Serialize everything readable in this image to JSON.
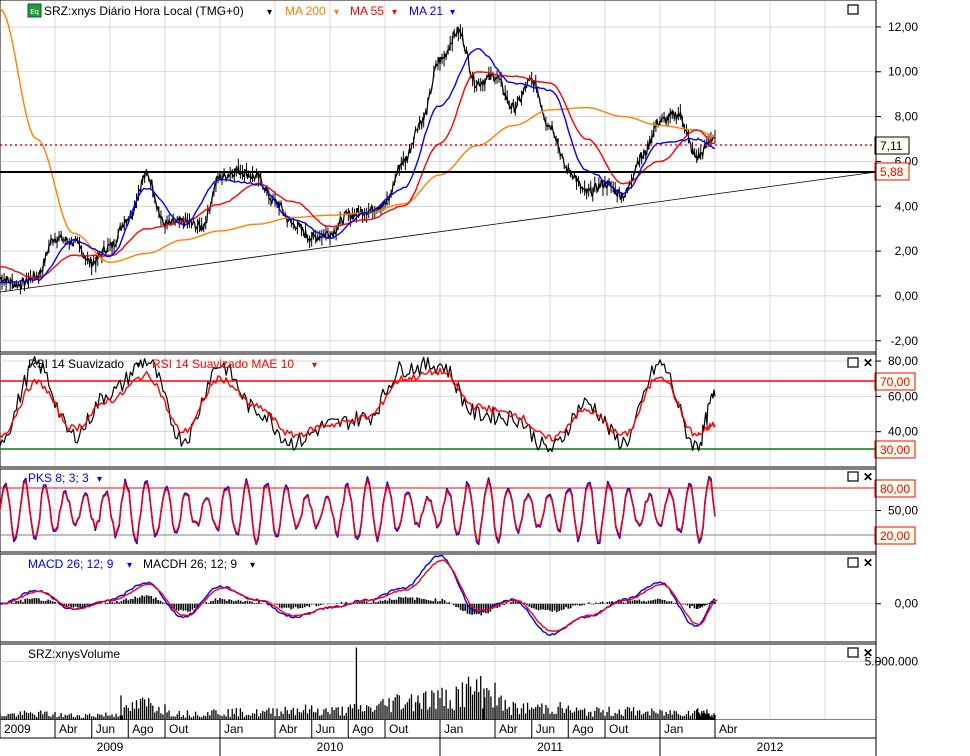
{
  "colors": {
    "price": "#000000",
    "ma200": "#ff8000",
    "ma55": "#ff0000",
    "ma21": "#0000ff",
    "rsi": "#000000",
    "rsi_ma": "#ff0000",
    "pks_k": "#0000ff",
    "pks_d": "#ff0000",
    "macd": "#0000ff",
    "macd_signal": "#ff0000",
    "macdh": "#000000",
    "level_upper": "#ff0000",
    "level_lower": "#008000",
    "volume": "#000000",
    "grid": "#c0c0c0",
    "badge_bg": "#ffffee",
    "badge_red_text": "#ff0000"
  },
  "icons": {
    "close": "close-icon",
    "maximize": "maximize-icon",
    "dropdown": "dropdown-arrow-icon",
    "eq_badge": "eq-badge-icon"
  },
  "price_panel": {
    "symbol_label": "SRZ:xnys Diário Hora Local (TMG+0)",
    "badge_text": "Eq",
    "ma200_label": "MA 200",
    "ma55_label": "MA 55",
    "ma21_label": "MA 21",
    "y_ticks": [
      "12,00",
      "10,00",
      "8,00",
      "6,00",
      "4,00",
      "2,00",
      "0,00",
      "-2,00"
    ],
    "last_price": "7,11",
    "support_level": "5,88"
  },
  "rsi_panel": {
    "label": "RSI 14 Suavizado",
    "ma_label": "RSI 14 Suavizado MAE 10",
    "y_ticks": [
      "80,00",
      "60,00",
      "40,00"
    ],
    "upper_level": "70,00",
    "lower_level": "30,00"
  },
  "pks_panel": {
    "label": "PKS 8; 3; 3",
    "y_ticks": [
      "50,00"
    ],
    "upper_level": "80,00",
    "lower_level": "20,00"
  },
  "macd_panel": {
    "label": "MACD 26; 12; 9",
    "hist_label": "MACDH 26; 12; 9",
    "y_ticks": [
      "0,00"
    ]
  },
  "volume_panel": {
    "label": "SRZ:xnysVolume",
    "y_ticks": [
      "5.000.000"
    ]
  },
  "time_axis": {
    "months": [
      "2009",
      "Abr",
      "Jun",
      "Ago",
      "Out",
      "Jan",
      "Abr",
      "Jun",
      "Ago",
      "Out",
      "Jan",
      "Abr",
      "Jun",
      "Ago",
      "Out",
      "Jan",
      "Abr"
    ],
    "years": [
      "2009",
      "2010",
      "2011",
      "2012"
    ]
  },
  "chart_data": [
    {
      "type": "line",
      "title": "SRZ:xnys Diário Hora Local (TMG+0)",
      "series": [
        {
          "name": "SRZ:xnys",
          "x": [
            "2009-01",
            "2009-02",
            "2009-03",
            "2009-04",
            "2009-05",
            "2009-06",
            "2009-07",
            "2009-08",
            "2009-09",
            "2009-10",
            "2009-11",
            "2009-12",
            "2010-01",
            "2010-02",
            "2010-03",
            "2010-04",
            "2010-05",
            "2010-06",
            "2010-07",
            "2010-08",
            "2010-09",
            "2010-10",
            "2010-11",
            "2010-12",
            "2011-01",
            "2011-02",
            "2011-03",
            "2011-04",
            "2011-05",
            "2011-06",
            "2011-07",
            "2011-08",
            "2011-09",
            "2011-10",
            "2011-11",
            "2011-12",
            "2012-01",
            "2012-02",
            "2012-03",
            "2012-04"
          ],
          "values": [
            0.8,
            0.5,
            0.9,
            2.6,
            2.4,
            1.5,
            2.2,
            3.5,
            5.4,
            3.2,
            3.3,
            3.1,
            5.3,
            5.6,
            5.3,
            4.2,
            3.2,
            2.6,
            2.8,
            3.6,
            3.8,
            4.1,
            6.0,
            7.8,
            10.5,
            11.8,
            9.5,
            9.8,
            8.4,
            9.6,
            7.6,
            5.6,
            4.6,
            5.0,
            4.5,
            6.2,
            7.8,
            8.1,
            6.2,
            7.11
          ]
        },
        {
          "name": "MA 200",
          "x": [
            "2009-01",
            "2009-03",
            "2009-05",
            "2009-07",
            "2009-09",
            "2009-11",
            "2010-01",
            "2010-03",
            "2010-05",
            "2010-07",
            "2010-09",
            "2010-11",
            "2011-01",
            "2011-03",
            "2011-05",
            "2011-07",
            "2011-09",
            "2011-11",
            "2012-01",
            "2012-03",
            "2012-04"
          ],
          "values": [
            12.8,
            7.0,
            2.8,
            1.5,
            1.9,
            2.5,
            2.9,
            3.2,
            3.5,
            3.6,
            3.7,
            4.1,
            5.4,
            6.7,
            7.6,
            8.3,
            8.4,
            8.0,
            7.6,
            7.4,
            7.1
          ]
        },
        {
          "name": "MA 55",
          "x": [
            "2009-01",
            "2009-03",
            "2009-05",
            "2009-07",
            "2009-09",
            "2009-11",
            "2010-01",
            "2010-03",
            "2010-05",
            "2010-07",
            "2010-09",
            "2010-11",
            "2011-01",
            "2011-03",
            "2011-05",
            "2011-07",
            "2011-09",
            "2011-11",
            "2012-01",
            "2012-03",
            "2012-04"
          ],
          "values": [
            1.3,
            0.8,
            1.8,
            1.8,
            3.0,
            3.3,
            4.1,
            5.0,
            4.2,
            3.1,
            3.4,
            4.0,
            6.8,
            10.0,
            9.8,
            9.5,
            7.0,
            5.0,
            6.0,
            7.4,
            6.8
          ]
        },
        {
          "name": "MA 21",
          "x": [
            "2009-01",
            "2009-03",
            "2009-05",
            "2009-07",
            "2009-09",
            "2009-11",
            "2010-01",
            "2010-03",
            "2010-05",
            "2010-07",
            "2010-09",
            "2010-11",
            "2011-01",
            "2011-03",
            "2011-05",
            "2011-07",
            "2011-09",
            "2011-11",
            "2012-01",
            "2012-03",
            "2012-04"
          ],
          "values": [
            0.6,
            0.7,
            2.5,
            1.8,
            4.8,
            3.2,
            5.2,
            5.0,
            3.4,
            2.6,
            3.7,
            4.8,
            8.5,
            11.0,
            9.5,
            9.2,
            5.6,
            4.6,
            6.8,
            7.0,
            6.6
          ]
        }
      ],
      "ylim": [
        -2.5,
        13.2
      ],
      "grid": true,
      "annotations": [
        "7,11",
        "5,88"
      ]
    },
    {
      "type": "line",
      "title": "RSI 14 Suavizado",
      "series": [
        {
          "name": "RSI 14 Suavizado",
          "x": [
            "2009-01",
            "2009-03",
            "2009-05",
            "2009-07",
            "2009-09",
            "2009-11",
            "2010-01",
            "2010-03",
            "2010-05",
            "2010-07",
            "2010-09",
            "2010-11",
            "2011-01",
            "2011-03",
            "2011-05",
            "2011-07",
            "2011-09",
            "2011-11",
            "2012-01",
            "2012-03",
            "2012-04"
          ],
          "values": [
            36,
            78,
            38,
            62,
            80,
            36,
            78,
            52,
            34,
            44,
            48,
            76,
            78,
            50,
            48,
            30,
            56,
            34,
            78,
            32,
            60
          ]
        },
        {
          "name": "RSI 14 Suavizado MAE 10",
          "x": [
            "2009-01",
            "2009-03",
            "2009-05",
            "2009-07",
            "2009-09",
            "2009-11",
            "2010-01",
            "2010-03",
            "2010-05",
            "2010-07",
            "2010-09",
            "2010-11",
            "2011-01",
            "2011-03",
            "2011-05",
            "2011-07",
            "2011-09",
            "2011-11",
            "2012-01",
            "2012-03",
            "2012-04"
          ],
          "values": [
            38,
            68,
            42,
            58,
            72,
            40,
            70,
            54,
            38,
            44,
            48,
            70,
            74,
            54,
            50,
            36,
            52,
            38,
            72,
            38,
            44
          ]
        }
      ],
      "ylim": [
        20,
        84
      ],
      "annotations": [
        "70,00",
        "30,00"
      ]
    },
    {
      "type": "line",
      "title": "PKS 8; 3; 3",
      "series": [
        {
          "name": "PKS 8; 3; 3",
          "x": [
            "2009-01",
            "2009-03",
            "2009-05",
            "2009-07",
            "2009-09",
            "2009-11",
            "2010-01",
            "2010-03",
            "2010-05",
            "2010-07",
            "2010-09",
            "2010-11",
            "2011-01",
            "2011-03",
            "2011-05",
            "2011-07",
            "2011-09",
            "2011-11",
            "2012-01",
            "2012-03",
            "2012-04"
          ],
          "values": [
            20,
            85,
            15,
            90,
            20,
            85,
            15,
            88,
            10,
            80,
            18,
            90,
            12,
            88,
            20,
            90,
            15,
            88,
            90,
            10,
            82
          ]
        }
      ],
      "ylim": [
        0,
        100
      ],
      "annotations": [
        "80,00",
        "20,00"
      ]
    },
    {
      "type": "line",
      "title": "MACD 26; 12; 9",
      "series": [
        {
          "name": "MACD 26; 12; 9",
          "x": [
            "2009-01",
            "2009-03",
            "2009-05",
            "2009-07",
            "2009-09",
            "2009-11",
            "2010-01",
            "2010-03",
            "2010-05",
            "2010-07",
            "2010-09",
            "2010-11",
            "2011-01",
            "2011-03",
            "2011-05",
            "2011-07",
            "2011-09",
            "2011-11",
            "2012-01",
            "2012-03",
            "2012-04"
          ],
          "values": [
            0.0,
            0.35,
            -0.15,
            0.1,
            0.55,
            -0.35,
            0.45,
            0.1,
            -0.35,
            -0.1,
            0.1,
            0.4,
            1.25,
            -0.2,
            0.1,
            -0.8,
            -0.35,
            0.1,
            0.55,
            -0.6,
            0.1
          ]
        },
        {
          "name": "MACDH 26; 12; 9",
          "x": [
            "2009-01",
            "2009-03",
            "2009-05",
            "2009-07",
            "2009-09",
            "2009-11",
            "2010-01",
            "2010-03",
            "2010-05",
            "2010-07",
            "2010-09",
            "2010-11",
            "2011-01",
            "2011-03",
            "2011-05",
            "2011-07",
            "2011-09",
            "2011-11",
            "2012-01",
            "2012-03",
            "2012-04"
          ],
          "values": [
            0.0,
            0.12,
            -0.1,
            0.05,
            0.2,
            -0.2,
            0.12,
            0.05,
            -0.12,
            0.0,
            0.05,
            0.15,
            0.1,
            -0.3,
            0.05,
            -0.2,
            0.0,
            0.05,
            0.1,
            -0.1,
            0.05
          ]
        }
      ],
      "ylim": [
        -1.0,
        1.3
      ]
    },
    {
      "type": "bar",
      "title": "SRZ:xnysVolume",
      "series": [
        {
          "name": "SRZ:xnysVolume",
          "x": [
            "2009-01",
            "2009-03",
            "2009-05",
            "2009-07",
            "2009-09",
            "2009-11",
            "2010-01",
            "2010-03",
            "2010-05",
            "2010-07",
            "2010-09",
            "2010-11",
            "2011-01",
            "2011-03",
            "2011-05",
            "2011-07",
            "2011-09",
            "2011-11",
            "2012-01",
            "2012-03",
            "2012-04"
          ],
          "values": [
            600000,
            700000,
            500000,
            600000,
            1800000,
            700000,
            900000,
            800000,
            1200000,
            1000000,
            1300000,
            2200000,
            2400000,
            3400000,
            1300000,
            1400000,
            900000,
            1000000,
            800000,
            1000000,
            700000
          ]
        }
      ],
      "ylim": [
        0,
        6500000
      ]
    }
  ]
}
